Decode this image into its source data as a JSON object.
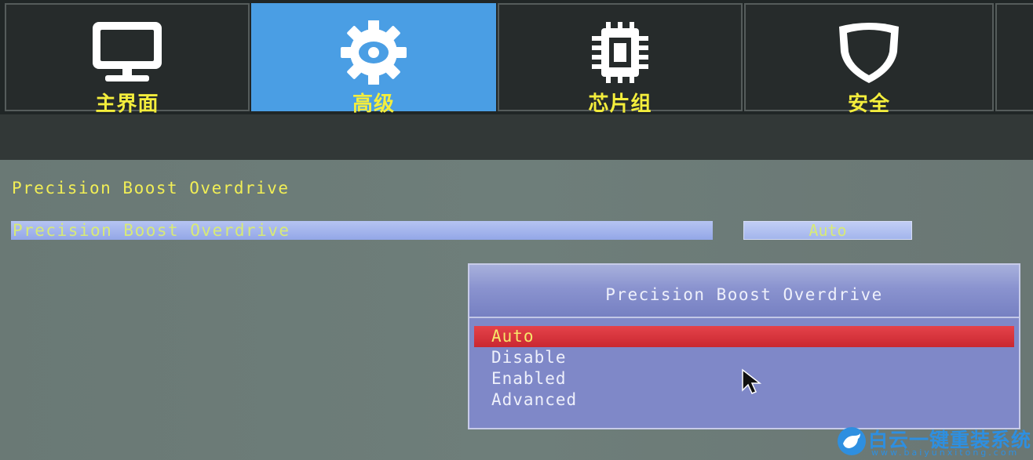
{
  "tabs": [
    {
      "label": "主界面",
      "icon": "monitor-icon",
      "active": false
    },
    {
      "label": "高级",
      "icon": "gear-icon",
      "active": true
    },
    {
      "label": "芯片组",
      "icon": "chip-icon",
      "active": false
    },
    {
      "label": "安全",
      "icon": "shield-icon",
      "active": false
    }
  ],
  "section": {
    "title": "Precision Boost Overdrive"
  },
  "setting": {
    "label": "Precision Boost Overdrive",
    "value": "Auto"
  },
  "popup": {
    "title": "Precision Boost Overdrive",
    "options": [
      "Auto",
      "Disable",
      "Enabled",
      "Advanced"
    ],
    "selected": "Auto"
  },
  "watermark": {
    "text": "白云一键重装系统",
    "url": "www.baiyunxitong.com"
  },
  "colors": {
    "accent_tab": "#4a9ee4",
    "label_yellow": "#f4ee3c",
    "selection_red": "#d9343c",
    "popup_bg": "#7f88c8"
  }
}
